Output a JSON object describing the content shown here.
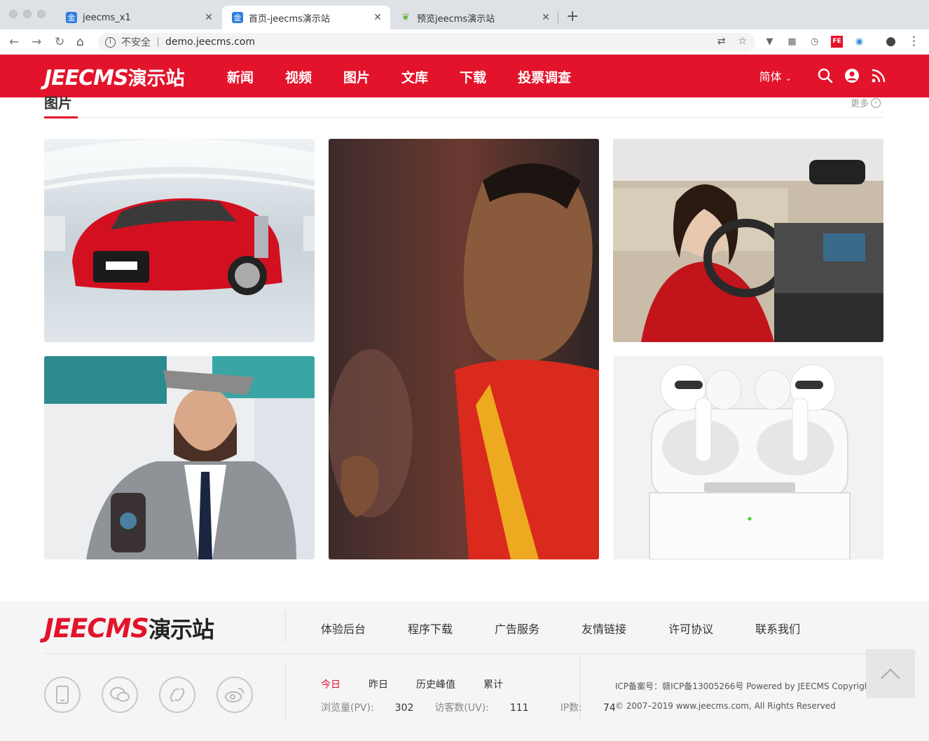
{
  "browser": {
    "tabs": [
      {
        "title": "jeecms_x1",
        "favicon": "金"
      },
      {
        "title": "首页-jeecms演示站",
        "favicon": "金"
      },
      {
        "title": "预览jeecms演示站",
        "favicon": "leaf-icon"
      }
    ],
    "security_label": "不安全",
    "url": "demo.jeecms.com"
  },
  "header": {
    "logo_en": "JEECMS",
    "logo_cn": "演示站",
    "nav": [
      "新闻",
      "视频",
      "图片",
      "文库",
      "下载",
      "投票调查"
    ],
    "lang": "简体"
  },
  "section": {
    "title": "图片",
    "more": "更多"
  },
  "gallery": [
    {
      "subject": "red sports car"
    },
    {
      "subject": "football player"
    },
    {
      "subject": "woman driving car"
    },
    {
      "subject": "man with phone"
    },
    {
      "subject": "wireless earbuds"
    }
  ],
  "footer": {
    "logo_en": "JEECMS",
    "logo_cn": "演示站",
    "links": [
      "体验后台",
      "程序下载",
      "广告服务",
      "友情链接",
      "许可协议",
      "联系我们"
    ],
    "stats_tabs": [
      "今日",
      "昨日",
      "历史峰值",
      "累计"
    ],
    "pv_label": "浏览量(PV):",
    "pv_value": "302",
    "uv_label": "访客数(UV):",
    "uv_value": "111",
    "ip_label": "IP数:",
    "ip_value": "74",
    "icp_line": "ICP备案号：赣ICP备13005266号 Powered by JEECMS Copyright",
    "copyright_line": "© 2007–2019 www.jeecms.com, All Rights Reserved"
  },
  "colors": {
    "brand": "#e3132b",
    "footer_bg": "#f5f5f5"
  }
}
